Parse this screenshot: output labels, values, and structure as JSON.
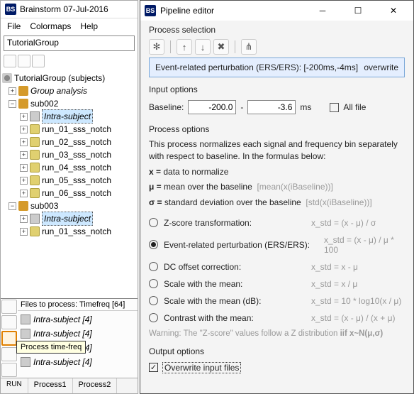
{
  "left": {
    "title": "Brainstorm 07-Jul-2016",
    "menu": {
      "file": "File",
      "colormaps": "Colormaps",
      "help": "Help"
    },
    "address": "TutorialGroup",
    "root": "TutorialGroup (subjects)",
    "group": "Group analysis",
    "sub002": {
      "name": "sub002",
      "intra": "Intra-subject",
      "runs": [
        "run_01_sss_notch",
        "run_02_sss_notch",
        "run_03_sss_notch",
        "run_04_sss_notch",
        "run_05_sss_notch",
        "run_06_sss_notch"
      ]
    },
    "sub003": {
      "name": "sub003",
      "intra": "Intra-subject",
      "runs": [
        "run_01_sss_notch"
      ]
    },
    "files": {
      "header": "Files to process: Timefreq [64]",
      "items": [
        "Intra-subject [4]",
        "Intra-subject [4]",
        "Intra-subject [4]",
        "Intra-subject [4]"
      ]
    },
    "tooltip": "Process time-freq",
    "bottom": {
      "run": "RUN",
      "p1": "Process1",
      "p2": "Process2"
    }
  },
  "right": {
    "title": "Pipeline editor",
    "ps": {
      "title": "Process selection",
      "entry": "Event-related perturbation (ERS/ERS): [-200ms,-4ms]",
      "entry_tag": "overwrite"
    },
    "input": {
      "title": "Input options",
      "baseline_label": "Baseline:",
      "v1": "-200.0",
      "sep": "-",
      "v2": "-3.6",
      "unit": "ms",
      "allfile": "All file"
    },
    "po": {
      "title": "Process options",
      "p1": "This process normalizes each signal and frequency bin separately with respect to baseline. In the formulas below:",
      "x": "x =",
      "xdesc": "data to normalize",
      "mu": "μ =",
      "mudesc": "mean over the baseline",
      "mugrey": "[mean(x(iBaseline))]",
      "sig": "σ =",
      "sigdesc": "standard deviation over the baseline",
      "siggrey": "[std(x(iBaseline))]",
      "opts": [
        {
          "label": "Z-score transformation:",
          "formula": "x_std = (x - μ) / σ",
          "sel": false
        },
        {
          "label": "Event-related perturbation (ERS/ERS):",
          "formula": "x_std = (x - μ) / μ * 100",
          "sel": true
        },
        {
          "label": "DC offset correction:",
          "formula": "x_std = x - μ",
          "sel": false
        },
        {
          "label": "Scale with the mean:",
          "formula": "x_std = x / μ",
          "sel": false
        },
        {
          "label": "Scale with the mean (dB):",
          "formula": "x_std = 10 * log10(x / μ)",
          "sel": false
        },
        {
          "label": "Contrast with the mean:",
          "formula": "x_std = (x - μ) / (x + μ)",
          "sel": false
        }
      ],
      "warn_a": "Warning: The \"Z-score\" values follow a Z distribution ",
      "warn_b": "iif x~N(μ,σ)"
    },
    "out": {
      "title": "Output options",
      "overwrite": "Overwrite input files"
    }
  }
}
